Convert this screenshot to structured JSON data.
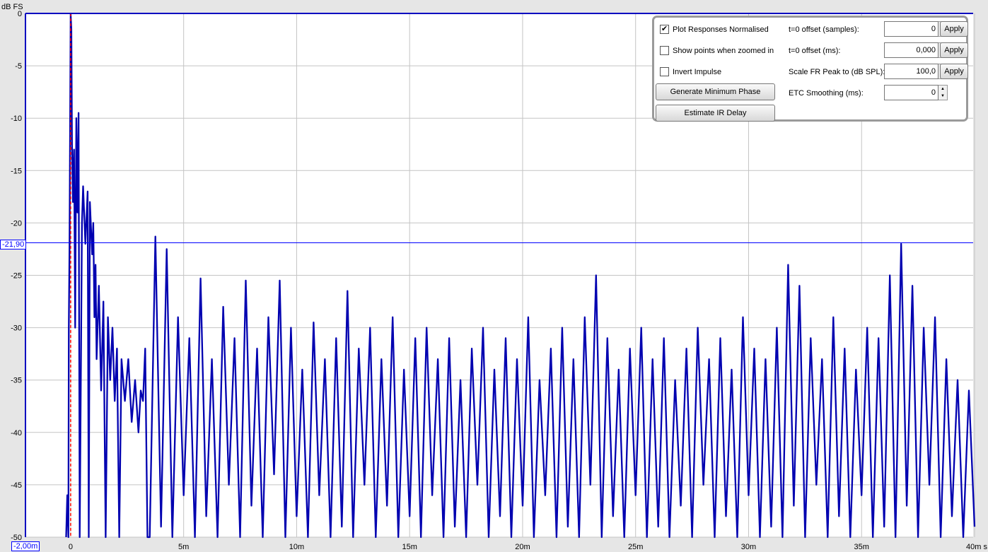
{
  "chart_data": {
    "type": "line",
    "ylabel": "dB FS",
    "xunit": "s",
    "xlim": [
      -2,
      40
    ],
    "ylim": [
      -50,
      0
    ],
    "grid": true,
    "yticks": [
      "0",
      "-5",
      "-10",
      "-15",
      "-20",
      "-25",
      "-30",
      "-35",
      "-40",
      "-45",
      "-50"
    ],
    "ytick_values": [
      0,
      -5,
      -10,
      -15,
      -20,
      -25,
      -30,
      -35,
      -40,
      -45,
      -50
    ],
    "xticks": [
      "0",
      "5m",
      "10m",
      "15m",
      "20m",
      "25m",
      "30m",
      "35m",
      "40m s"
    ],
    "xtick_values": [
      0,
      5,
      10,
      15,
      20,
      25,
      30,
      35,
      40
    ],
    "series_color": "#0000b0",
    "cursor": {
      "y_label": "-21,90",
      "y_value": -21.9,
      "x_label": "-2,00m",
      "x_value": -2.0,
      "color": "#0000ff"
    },
    "t0_marker": {
      "x_value": 0,
      "color": "#ff0000",
      "style": "dashed"
    },
    "points_early": [
      [
        -0.2,
        -50
      ],
      [
        -0.15,
        -46
      ],
      [
        -0.1,
        -50
      ],
      [
        -0.08,
        -30
      ],
      [
        -0.05,
        -22
      ],
      [
        0,
        0
      ],
      [
        0.03,
        -1.5
      ],
      [
        0.06,
        -12.5
      ],
      [
        0.1,
        -18
      ],
      [
        0.15,
        -13
      ],
      [
        0.2,
        -30
      ],
      [
        0.25,
        -10
      ],
      [
        0.3,
        -19
      ],
      [
        0.35,
        -9.5
      ],
      [
        0.4,
        -50
      ],
      [
        0.5,
        -20
      ],
      [
        0.55,
        -16.5
      ],
      [
        0.65,
        -22
      ],
      [
        0.75,
        -17
      ],
      [
        0.8,
        -50
      ],
      [
        0.85,
        -18
      ],
      [
        0.95,
        -23
      ],
      [
        1.0,
        -20
      ],
      [
        1.05,
        -29
      ],
      [
        1.1,
        -24
      ],
      [
        1.15,
        -33
      ],
      [
        1.25,
        -26
      ],
      [
        1.35,
        -36
      ],
      [
        1.45,
        -27.5
      ],
      [
        1.55,
        -50
      ],
      [
        1.65,
        -29
      ],
      [
        1.75,
        -35
      ],
      [
        1.85,
        -30
      ],
      [
        1.95,
        -37
      ],
      [
        2.05,
        -32
      ],
      [
        2.15,
        -50
      ],
      [
        2.25,
        -33
      ],
      [
        2.4,
        -37
      ],
      [
        2.55,
        -33
      ],
      [
        2.7,
        -39
      ],
      [
        2.85,
        -35
      ],
      [
        3.0,
        -40
      ],
      [
        3.1,
        -36
      ],
      [
        3.2,
        -37
      ],
      [
        3.3,
        -32
      ],
      [
        3.4,
        -50
      ]
    ],
    "late_x_start": 3.5,
    "late_x_step": 0.25,
    "late_values": [
      -50,
      -21.3,
      -49,
      -22.5,
      -50,
      -29,
      -46,
      -31,
      -50,
      -25.3,
      -48,
      -33,
      -50,
      -28,
      -45,
      -31,
      -50,
      -25.5,
      -47,
      -32,
      -50,
      -29,
      -44,
      -25.5,
      -50,
      -30,
      -48,
      -34,
      -50,
      -29.5,
      -46,
      -33,
      -50,
      -31,
      -49,
      -26.5,
      -50,
      -32,
      -45,
      -30,
      -50,
      -33,
      -47,
      -29,
      -50,
      -34,
      -48,
      -31,
      -50,
      -30,
      -46,
      -33,
      -50,
      -31,
      -49,
      -35,
      -50,
      -32,
      -45,
      -30,
      -50,
      -34,
      -48,
      -31,
      -50,
      -33,
      -47,
      -29,
      -50,
      -35,
      -46,
      -32,
      -50,
      -30,
      -49,
      -33,
      -50,
      -29,
      -45,
      -25,
      -50,
      -31,
      -48,
      -34,
      -50,
      -32,
      -46,
      -30,
      -50,
      -33,
      -49,
      -31,
      -50,
      -35,
      -47,
      -32,
      -50,
      -30,
      -45,
      -33,
      -50,
      -31,
      -48,
      -34,
      -50,
      -29,
      -46,
      -32,
      -50,
      -33,
      -49,
      -30,
      -50,
      -24,
      -47,
      -26,
      -50,
      -31,
      -45,
      -33,
      -50,
      -29,
      -48,
      -32,
      -50,
      -34,
      -46,
      -30,
      -50,
      -31,
      -49,
      -25,
      -50,
      -22,
      -47,
      -26,
      -50,
      -30,
      -45,
      -29,
      -50,
      -33,
      -48,
      -35,
      -50,
      -36,
      -49,
      -37,
      -50
    ]
  },
  "panel": {
    "checkboxes": [
      {
        "label": "Plot Responses Normalised",
        "checked": true
      },
      {
        "label": "Show points when zoomed in",
        "checked": false
      },
      {
        "label": "Invert Impulse",
        "checked": false
      }
    ],
    "buttons": {
      "min_phase": "Generate Minimum Phase",
      "ir_delay": "Estimate IR Delay",
      "apply": "Apply"
    },
    "fields": [
      {
        "label": "t=0 offset (samples):",
        "value": "0"
      },
      {
        "label": "t=0 offset (ms):",
        "value": "0,000"
      },
      {
        "label": "Scale FR Peak to (dB SPL):",
        "value": "100,0"
      },
      {
        "label": "ETC Smoothing (ms):",
        "value": "0"
      }
    ]
  }
}
